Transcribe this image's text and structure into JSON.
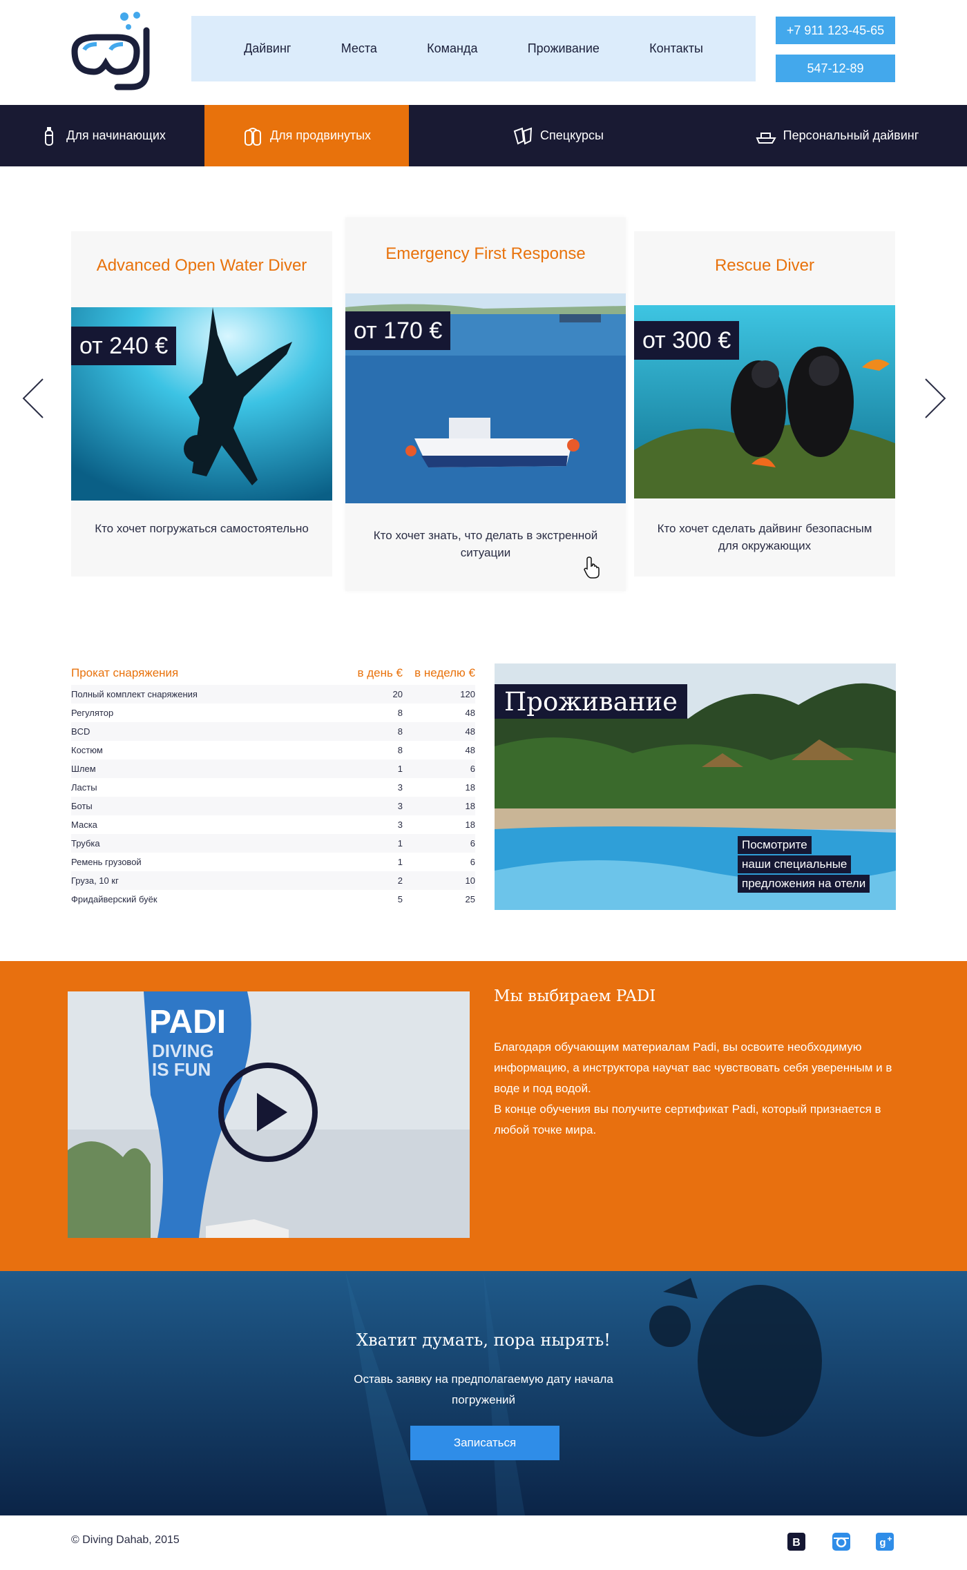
{
  "header": {
    "nav": [
      "Дайвинг",
      "Места",
      "Команда",
      "Проживание",
      "Контакты"
    ],
    "phone1": "+7 911 123-45-65",
    "phone2": "547-12-89"
  },
  "categories": [
    {
      "label": "Для начинающих",
      "icon": "scuba-tank-icon"
    },
    {
      "label": "Для продвинутых",
      "icon": "double-tank-icon",
      "active": true
    },
    {
      "label": "Спецкурсы",
      "icon": "fins-icon"
    },
    {
      "label": "Персональный дайвинг",
      "icon": "boat-icon"
    }
  ],
  "courses": [
    {
      "title": "Advanced Open Water Diver",
      "price": "от 240 €",
      "desc": "Кто хочет погружаться самостоятельно"
    },
    {
      "title": "Emergency First Response",
      "price": "от 170 €",
      "desc": "Кто хочет знать, что делать в экстренной ситуации"
    },
    {
      "title": "Rescue Diver",
      "price": "от 300 €",
      "desc": "Кто хочет сделать дайвинг безопасным для окружающих"
    }
  ],
  "rental": {
    "headers": [
      "Прокат снаряжения",
      "в день €",
      "в неделю €"
    ],
    "rows": [
      [
        "Полный комплект снаряжения",
        "20",
        "120"
      ],
      [
        "Регулятор",
        "8",
        "48"
      ],
      [
        "BCD",
        "8",
        "48"
      ],
      [
        "Костюм",
        "8",
        "48"
      ],
      [
        "Шлем",
        "1",
        "6"
      ],
      [
        "Ласты",
        "3",
        "18"
      ],
      [
        "Боты",
        "3",
        "18"
      ],
      [
        "Маска",
        "3",
        "18"
      ],
      [
        "Трубка",
        "1",
        "6"
      ],
      [
        "Ремень грузовой",
        "1",
        "6"
      ],
      [
        "Груза, 10 кг",
        "2",
        "10"
      ],
      [
        "Фридайверский буёк",
        "5",
        "25"
      ]
    ]
  },
  "accommodation": {
    "title": "Проживание",
    "offer": [
      "Посмотрите",
      "наши специальные",
      "предложения на отели"
    ]
  },
  "padi": {
    "title": "Мы выбираем PADI",
    "text1": "Благодаря обучающим материалам Padi,  вы освоите необходимую информацию, а инструктора научат вас чувствовать себя уверенным и в воде и под водой.",
    "text2": "В конце обучения вы получите сертификат Padi, который признается в любой точке мира.",
    "flag_text": "PADI DIVING IS FUN"
  },
  "cta": {
    "title": "Хватит думать, пора нырять!",
    "text": "Оставь заявку на предполагаемую дату начала погружений",
    "button": "Записаться"
  },
  "footer": {
    "copyright": "© Diving Dahab, 2015",
    "social": [
      "vk-icon",
      "instagram-icon",
      "google-plus-icon"
    ]
  },
  "colors": {
    "accent": "#e8720c",
    "dark": "#191a33",
    "blue": "#43a8ec",
    "nav_bg": "#dcecfb"
  }
}
